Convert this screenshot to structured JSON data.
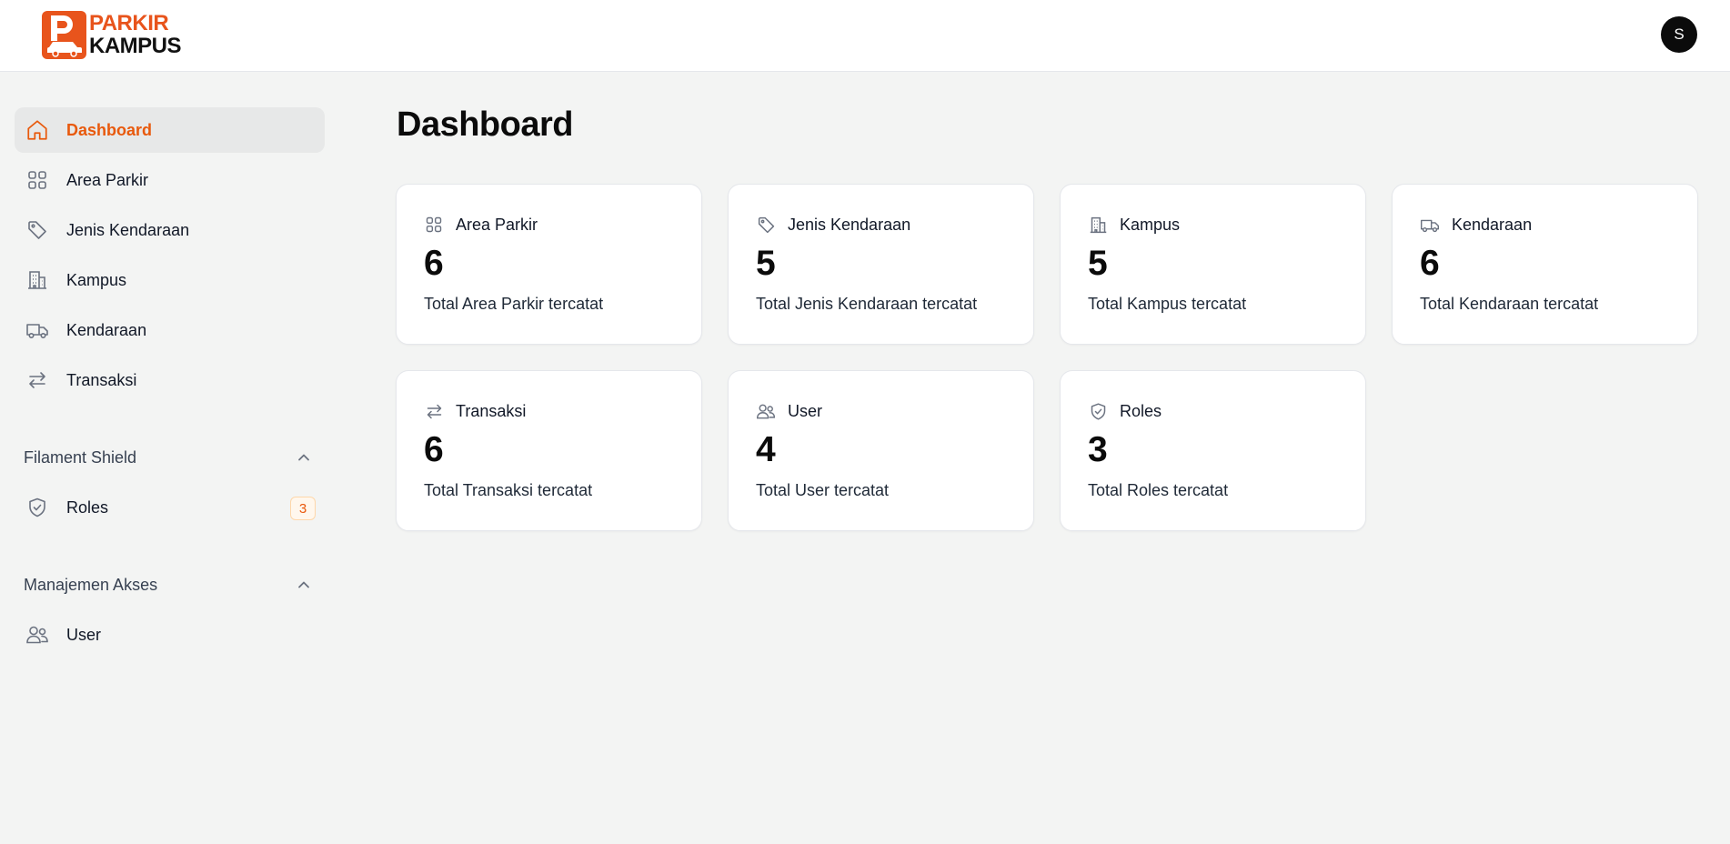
{
  "brand": {
    "line1": "PARKIR",
    "line2": "KAMPUS",
    "accent_color": "#e8541c"
  },
  "user": {
    "initial": "S"
  },
  "sidebar": {
    "items": [
      {
        "label": "Dashboard",
        "icon": "home-icon",
        "active": true
      },
      {
        "label": "Area Parkir",
        "icon": "grid-icon"
      },
      {
        "label": "Jenis Kendaraan",
        "icon": "tag-icon"
      },
      {
        "label": "Kampus",
        "icon": "building-icon"
      },
      {
        "label": "Kendaraan",
        "icon": "truck-icon"
      },
      {
        "label": "Transaksi",
        "icon": "arrows-exchange-icon"
      }
    ],
    "groups": [
      {
        "label": "Filament Shield",
        "items": [
          {
            "label": "Roles",
            "icon": "shield-check-icon",
            "badge": "3"
          }
        ]
      },
      {
        "label": "Manajemen Akses",
        "items": [
          {
            "label": "User",
            "icon": "users-icon"
          }
        ]
      }
    ]
  },
  "main": {
    "title": "Dashboard",
    "cards": [
      {
        "label": "Area Parkir",
        "value": "6",
        "desc": "Total Area Parkir tercatat",
        "icon": "grid-icon"
      },
      {
        "label": "Jenis Kendaraan",
        "value": "5",
        "desc": "Total Jenis Kendaraan tercatat",
        "icon": "tag-icon"
      },
      {
        "label": "Kampus",
        "value": "5",
        "desc": "Total Kampus tercatat",
        "icon": "building-icon"
      },
      {
        "label": "Kendaraan",
        "value": "6",
        "desc": "Total Kendaraan tercatat",
        "icon": "truck-icon"
      },
      {
        "label": "Transaksi",
        "value": "6",
        "desc": "Total Transaksi tercatat",
        "icon": "arrows-exchange-icon"
      },
      {
        "label": "User",
        "value": "4",
        "desc": "Total User tercatat",
        "icon": "users-icon"
      },
      {
        "label": "Roles",
        "value": "3",
        "desc": "Total Roles tercatat",
        "icon": "shield-check-icon"
      }
    ]
  }
}
